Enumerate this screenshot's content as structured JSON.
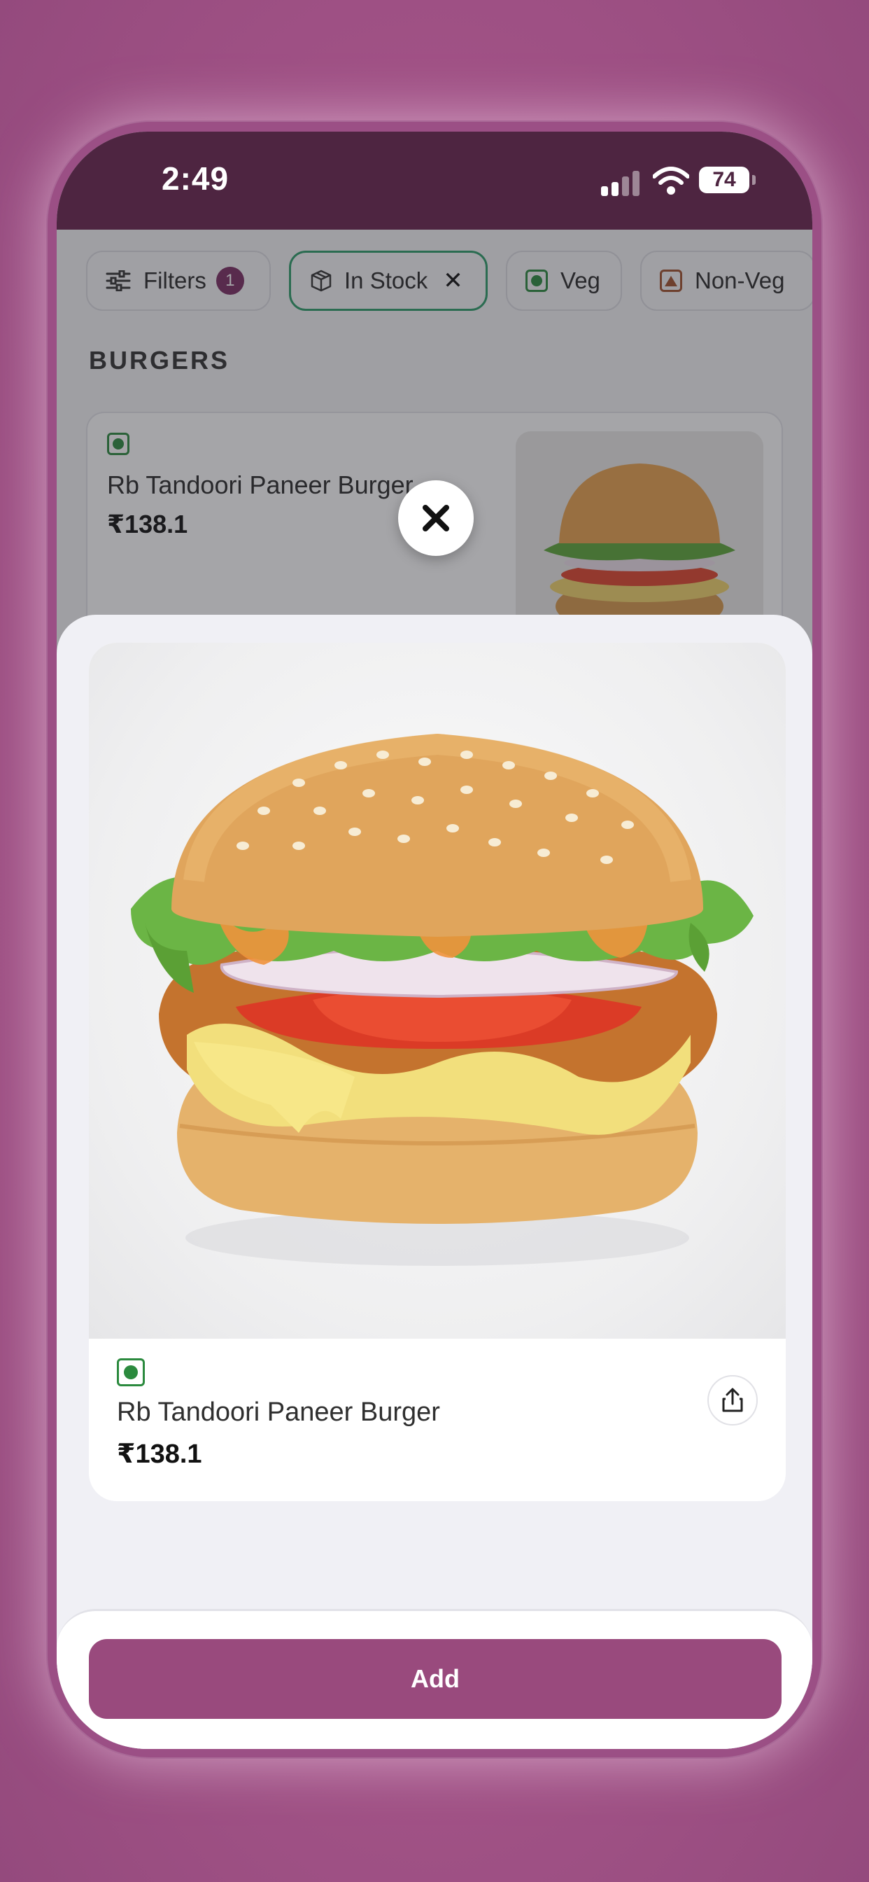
{
  "status": {
    "time": "2:49",
    "battery": "74"
  },
  "filters": {
    "filters_label": "Filters",
    "filters_count": "1",
    "in_stock_label": "In Stock",
    "veg_label": "Veg",
    "nonveg_label": "Non-Veg"
  },
  "section": {
    "title": "BURGERS"
  },
  "background_item": {
    "name": "Rb Tandoori Paneer Burger",
    "price": "₹138.1"
  },
  "detail": {
    "name": "Rb Tandoori Paneer Burger",
    "price": "₹138.1"
  },
  "footer": {
    "add_label": "Add"
  },
  "colors": {
    "accent": "#994a7d",
    "status_bar": "#4e2541",
    "veg": "#2b8a3e",
    "in_stock_border": "#2e9d6a"
  },
  "icons": [
    "sliders-icon",
    "package-icon",
    "close-icon",
    "veg-icon",
    "nonveg-icon",
    "share-icon",
    "signal-icon",
    "wifi-icon",
    "battery-icon"
  ]
}
